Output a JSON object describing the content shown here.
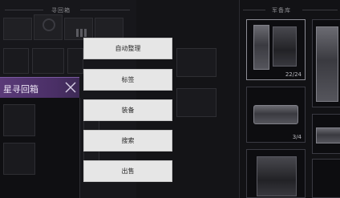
{
  "left_panel": {
    "header": "寻回箱",
    "retrieval_box_title": "星寻回箱",
    "close_icon": "close-x-icon"
  },
  "context_menu": {
    "items": [
      "自动整理",
      "标签",
      "装备",
      "搜索",
      "出售"
    ]
  },
  "right_panel": {
    "header": "军备库",
    "slot_counts": [
      "22/24",
      "3/4"
    ]
  },
  "colors": {
    "accent_purple": "#5a3a78",
    "menu_bg": "#e6e6e6",
    "panel_bg": "#17171b"
  }
}
